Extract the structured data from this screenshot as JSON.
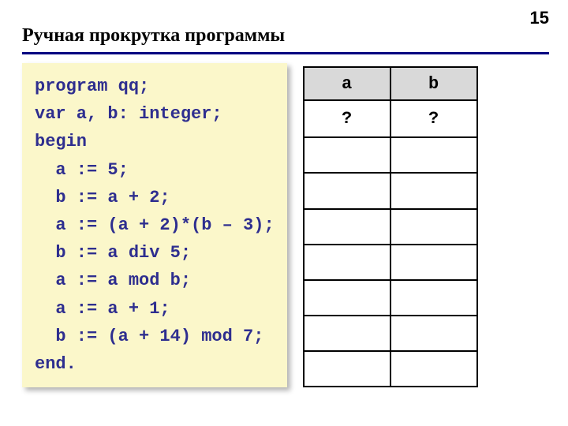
{
  "page_number": "15",
  "title": "Ручная прокрутка программы",
  "code": "program qq;\nvar a, b: integer;\nbegin\n  a := 5;\n  b := a + 2;\n  a := (a + 2)*(b – 3);\n  b := a div 5;\n  a := a mod b;\n  a := a + 1;\n  b := (a + 14) mod 7;\nend.",
  "table": {
    "headers": [
      "a",
      "b"
    ],
    "rows": [
      [
        "?",
        "?"
      ],
      [
        "",
        ""
      ],
      [
        "",
        ""
      ],
      [
        "",
        ""
      ],
      [
        "",
        ""
      ],
      [
        "",
        ""
      ],
      [
        "",
        ""
      ],
      [
        "",
        ""
      ]
    ]
  }
}
